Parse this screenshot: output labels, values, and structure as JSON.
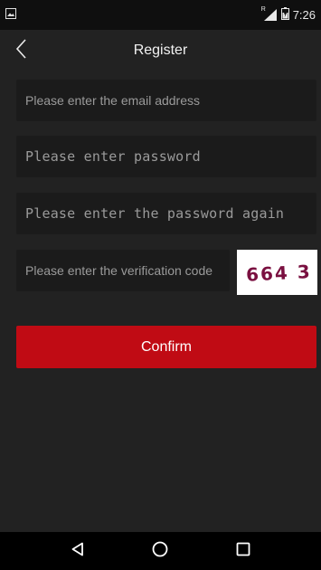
{
  "status_bar": {
    "time": "7:26",
    "roaming_indicator": "R",
    "icons": [
      "image-notification-icon",
      "signal-icon",
      "battery-icon"
    ]
  },
  "header": {
    "title": "Register",
    "back_icon": "back-arrow-icon"
  },
  "form": {
    "email_placeholder": "Please enter the email address",
    "password_placeholder": "Please enter password",
    "password_again_placeholder": "Please enter the password again",
    "verification_placeholder": "Please enter the verification code",
    "captcha_text": "664 3",
    "confirm_label": "Confirm"
  },
  "nav_bar": {
    "icons": [
      "back-triangle-icon",
      "home-circle-icon",
      "recents-square-icon"
    ]
  },
  "colors": {
    "background": "#222222",
    "field": "#1b1b1b",
    "accent": "#c00b14",
    "captcha_ink": "#7a1040"
  }
}
